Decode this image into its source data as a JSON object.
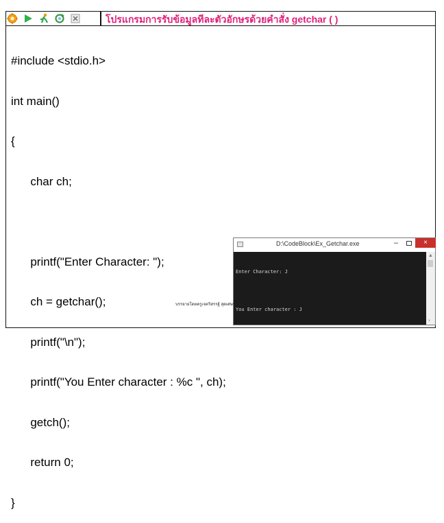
{
  "slide": {
    "title": "โปรแกรมการรับข้อมูลทีละตัวอักษรด้วยคำสั่ง getchar ( )",
    "toolbar_icons": [
      "settings-gear-icon",
      "play-icon",
      "run-person-icon",
      "refresh-icon",
      "close-box-icon"
    ],
    "code_lines": [
      "#include <stdio.h>",
      "int main()",
      "{",
      "      char ch;",
      "",
      "      printf(\"Enter Character: \");",
      "      ch = getchar();",
      "      printf(\"\\n\");",
      "      printf(\"You Enter character : %c \", ch);",
      "      getch();",
      "      return 0;",
      "}"
    ],
    "footer": "บรรยายโดยครูเจตวิสรรฐ์ สุดเศษพาคหา"
  },
  "console": {
    "title": "D:\\CodeBlock\\Ex_Getchar.exe",
    "min_label": "–",
    "close_label": "×",
    "output_lines": [
      "Enter Character: J",
      "",
      "You Enter character : J"
    ]
  },
  "colors": {
    "title": "#e0207a",
    "console_bg": "#1b1b1b",
    "close": "#c9302c"
  }
}
